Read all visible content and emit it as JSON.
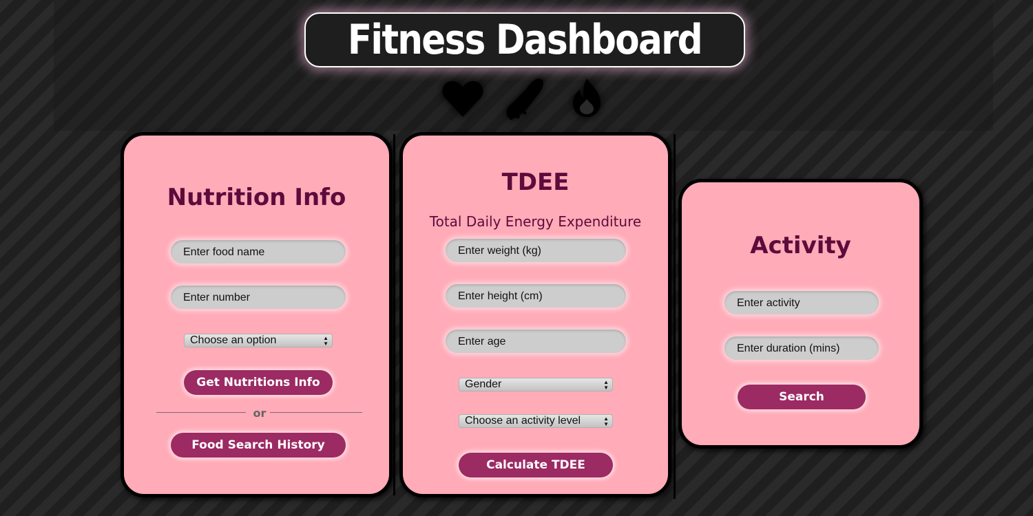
{
  "header": {
    "title": "Fitness Dashboard",
    "icons": [
      "heart-icon",
      "sneaker-icon",
      "fire-icon"
    ]
  },
  "nutrition": {
    "title": "Nutrition Info",
    "food_placeholder": "Enter food name",
    "number_placeholder": "Enter number",
    "select_value": "Choose an option",
    "get_button": "Get Nutritions Info",
    "or_text": "or",
    "history_button": "Food Search History"
  },
  "tdee": {
    "title": "TDEE",
    "subtitle": "Total Daily Energy Expenditure",
    "weight_placeholder": "Enter weight (kg)",
    "height_placeholder": "Enter height (cm)",
    "age_placeholder": "Enter age",
    "gender_value": "Gender",
    "activity_level_value": "Choose an activity level",
    "calculate_button": "Calculate TDEE"
  },
  "activity": {
    "title": "Activity",
    "activity_placeholder": "Enter activity",
    "duration_placeholder": "Enter duration (mins)",
    "search_button": "Search"
  },
  "colors": {
    "card_bg": "#ffabb8",
    "title_color": "#5c0b3b",
    "button_bg": "#9c2a63",
    "input_bg": "#cdcdcd",
    "page_bg": "#242424"
  }
}
